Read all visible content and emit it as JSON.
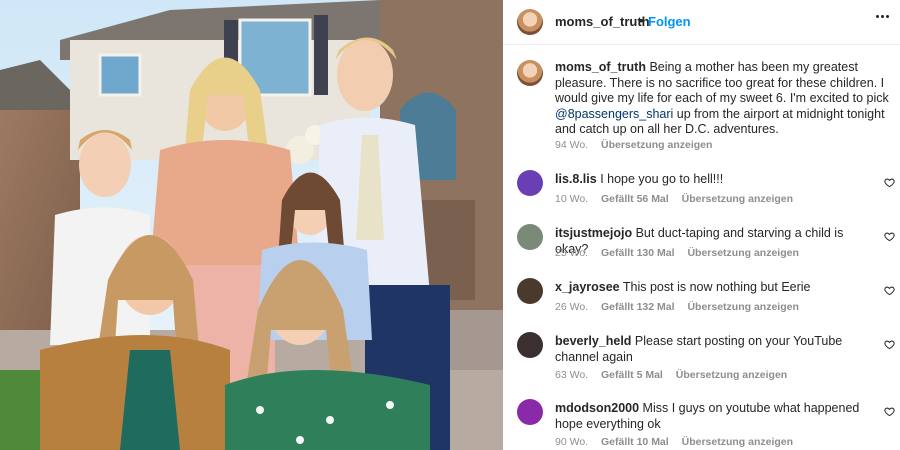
{
  "post": {
    "username": "moms_of_truth",
    "follow_label": "Folgen",
    "caption_text_before": "Being a mother has been my greatest pleasure. There is no sacrifice too great for these children. I would give my life for each of my sweet 6. I'm excited to pick ",
    "caption_mention": "@8passengers_shari",
    "caption_text_after": " up from the airport at midnight tonight and catch up on all her D.C. adventures.",
    "caption_age": "94 Wo.",
    "caption_translate": "Übersetzung anzeigen"
  },
  "comments": [
    {
      "user": "lis.8.lis",
      "text": "I hope you go to hell!!!",
      "age": "10 Wo.",
      "likes": "Gefällt 56 Mal",
      "translate": "Übersetzung anzeigen",
      "avatar_color": "#6a3fb3"
    },
    {
      "user": "itsjustmejojo",
      "text": "But duct-taping and starving a child is okay?",
      "age": "25 Wo.",
      "likes": "Gefällt 130 Mal",
      "translate": "Übersetzung anzeigen",
      "avatar_color": "#7a8a78"
    },
    {
      "user": "x_jayrosee",
      "text": "This post is now nothing but Eerie",
      "age": "26 Wo.",
      "likes": "Gefällt 132 Mal",
      "translate": "Übersetzung anzeigen",
      "avatar_color": "#4a3a2e"
    },
    {
      "user": "beverly_held",
      "text": "Please start posting on your YouTube channel again",
      "age": "63 Wo.",
      "likes": "Gefällt 5 Mal",
      "translate": "Übersetzung anzeigen",
      "avatar_color": "#3b3030"
    },
    {
      "user": "mdodson2000",
      "text": "Miss I guys on youtube what happened hope everything ok",
      "age": "90 Wo.",
      "likes": "Gefällt 10 Mal",
      "translate": "Übersetzung anzeigen",
      "avatar_color": "#8a2aa8"
    }
  ],
  "colors": {
    "accent": "#0095f6",
    "mention": "#00376b",
    "muted": "#8e8e8e"
  },
  "icons": {
    "more": "more-horizontal-icon",
    "like": "heart-outline-icon"
  }
}
